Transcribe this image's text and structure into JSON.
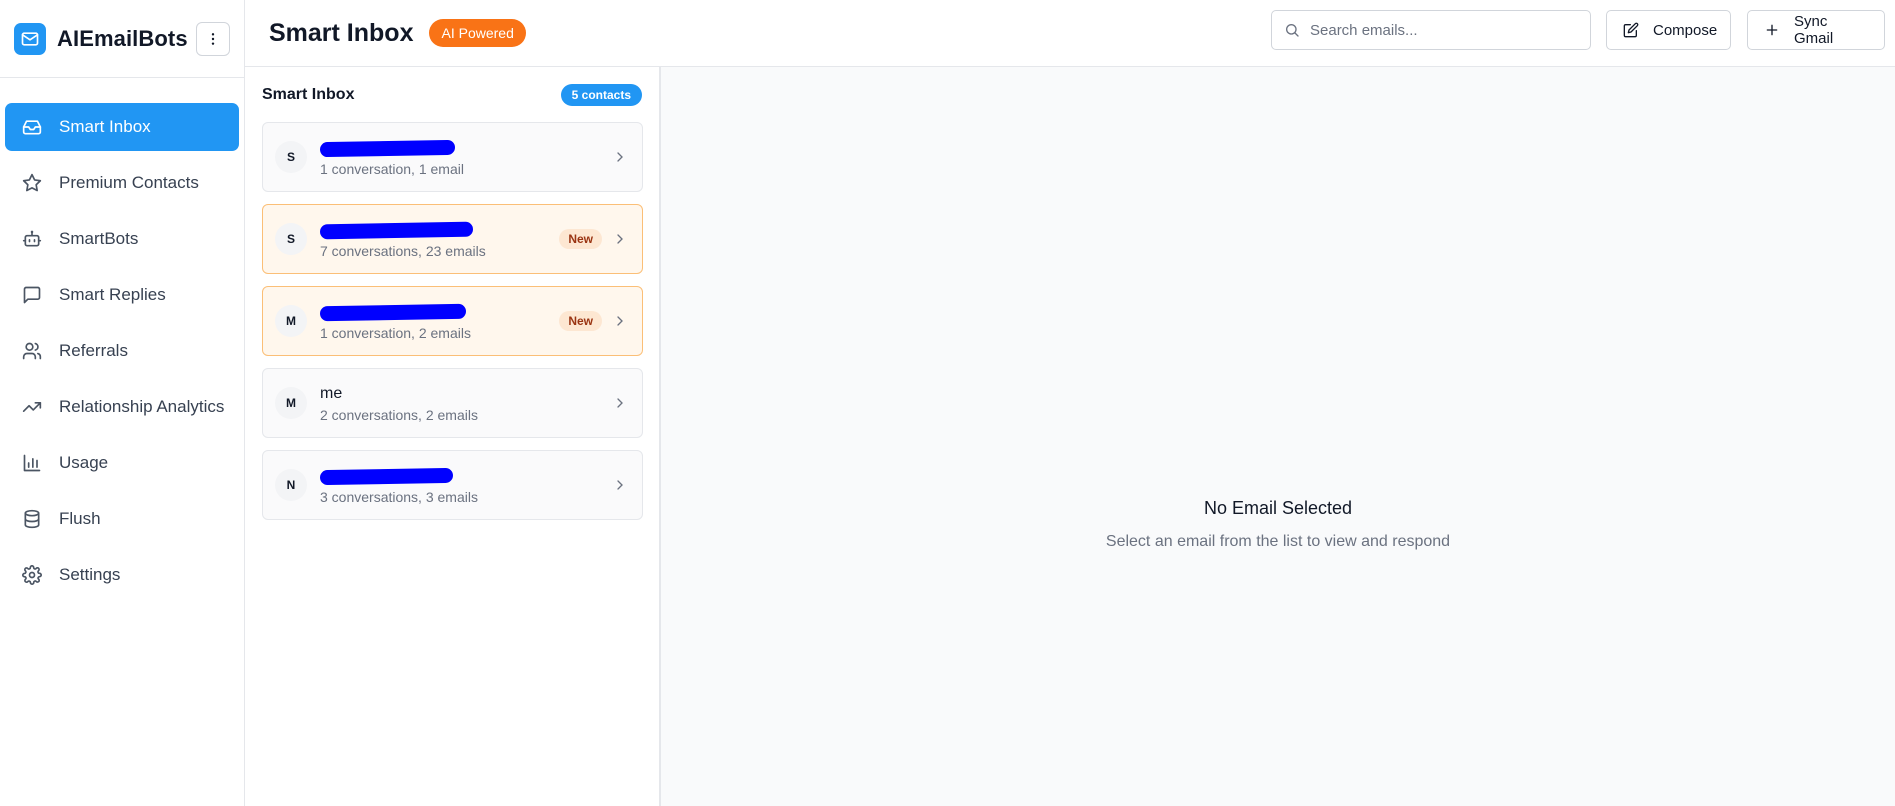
{
  "brand": {
    "name": "AIEmailBots",
    "icon": "mail-icon",
    "accent": "#2196f3"
  },
  "sidebar": {
    "items": [
      {
        "label": "Smart Inbox",
        "icon": "inbox-icon",
        "active": true
      },
      {
        "label": "Premium Contacts",
        "icon": "star-icon"
      },
      {
        "label": "SmartBots",
        "icon": "bot-icon"
      },
      {
        "label": "Smart Replies",
        "icon": "message-icon"
      },
      {
        "label": "Referrals",
        "icon": "users-icon"
      },
      {
        "label": "Relationship Analytics",
        "icon": "trending-up-icon"
      },
      {
        "label": "Usage",
        "icon": "bar-chart-icon"
      },
      {
        "label": "Flush",
        "icon": "database-icon"
      },
      {
        "label": "Settings",
        "icon": "gear-icon"
      }
    ]
  },
  "header": {
    "title": "Smart Inbox",
    "badge": "AI Powered",
    "badge_color": "#f97316",
    "search_placeholder": "Search emails...",
    "compose_label": "Compose",
    "sync_label": "Sync Gmail"
  },
  "list": {
    "title": "Smart Inbox",
    "count_badge": "5 contacts",
    "new_label": "New",
    "contacts": [
      {
        "initial": "S",
        "name": "",
        "redacted": true,
        "meta": "1 conversation, 1 email",
        "is_new": false
      },
      {
        "initial": "S",
        "name": "",
        "redacted": true,
        "meta": "7 conversations, 23 emails",
        "is_new": true
      },
      {
        "initial": "M",
        "name": "",
        "redacted": true,
        "meta": "1 conversation, 2 emails",
        "is_new": true
      },
      {
        "initial": "M",
        "name": "me",
        "redacted": false,
        "meta": "2 conversations, 2 emails",
        "is_new": false
      },
      {
        "initial": "N",
        "name": "",
        "redacted": true,
        "meta": "3 conversations, 3 emails",
        "is_new": false
      }
    ]
  },
  "detail": {
    "empty_title": "No Email Selected",
    "empty_subtitle": "Select an email from the list to view and respond"
  }
}
